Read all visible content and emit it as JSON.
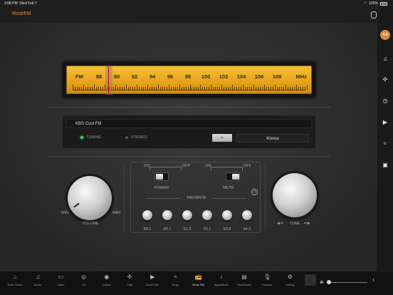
{
  "status": {
    "time": "2:08 PM",
    "date": "Wed Feb 7",
    "battery": "100%"
  },
  "app": {
    "title": "RoseFM",
    "accent": "#e98a3a"
  },
  "dial": {
    "band": "FM",
    "unit": "MHz",
    "numbers": [
      "88",
      "90",
      "92",
      "94",
      "96",
      "98",
      "100",
      "102",
      "104",
      "106",
      "108"
    ],
    "frequency_mhz": 89.1,
    "range_mhz": [
      87.5,
      108.5
    ]
  },
  "station": {
    "name": "KBS Cool FM",
    "tuning_label": "TUNING",
    "stereo_label": "STEREO",
    "tuning_on": true,
    "stereo_on": false,
    "region": "Korea"
  },
  "volume": {
    "label": "VOLUME",
    "min": "MIN",
    "max": "MAX"
  },
  "power": {
    "on": "ON",
    "off": "OFF",
    "label": "POWER",
    "state": "on"
  },
  "mute": {
    "on": "ON",
    "off": "OFF",
    "label": "MUTE",
    "state": "off"
  },
  "help": "?",
  "favorite": {
    "label": "FAVORITE",
    "stations": [
      "89.1",
      "89.7",
      "91.9",
      "93.1",
      "93.9",
      "94.5"
    ]
  },
  "tune": {
    "label": "TUNE"
  },
  "sidebar": [
    {
      "icon": "active-badge-icon",
      "glyph": "4:0",
      "active": true
    },
    {
      "icon": "music-note-icon",
      "glyph": "♫",
      "active": false
    },
    {
      "icon": "tidal-icon",
      "glyph": "✣",
      "active": false
    },
    {
      "icon": "clock-icon",
      "glyph": "◷",
      "active": false
    },
    {
      "icon": "youtube-icon",
      "glyph": "▶",
      "active": false
    },
    {
      "icon": "bugs-icon",
      "glyph": "≈",
      "active": false
    },
    {
      "icon": "roon-icon",
      "glyph": "▣",
      "active": false
    }
  ],
  "nav": [
    {
      "label": "Rose Home",
      "icon": "home-icon",
      "glyph": "⌂"
    },
    {
      "label": "Music",
      "icon": "music-icon",
      "glyph": "♫"
    },
    {
      "label": "Video",
      "icon": "video-icon",
      "glyph": "▭"
    },
    {
      "label": "CD",
      "icon": "cd-icon",
      "glyph": "◎"
    },
    {
      "label": "QoBuz",
      "icon": "qobuz-icon",
      "glyph": "◉"
    },
    {
      "label": "Tidal",
      "icon": "tidal-icon",
      "glyph": "✣"
    },
    {
      "label": "RoseTube",
      "icon": "rosetube-icon",
      "glyph": "▶"
    },
    {
      "label": "Bugs",
      "icon": "bugs-icon",
      "glyph": "≈"
    },
    {
      "label": "Rose FM",
      "icon": "radio-icon",
      "glyph": "📻",
      "active": true
    },
    {
      "label": "AppleMusic",
      "icon": "applemusic-icon",
      "glyph": "♪"
    },
    {
      "label": "RoseRadio",
      "icon": "roseradio-icon",
      "glyph": "▤"
    },
    {
      "label": "Podcast",
      "icon": "podcast-icon",
      "glyph": "🎙"
    },
    {
      "label": "Setting",
      "icon": "gear-icon",
      "glyph": "⚙"
    }
  ],
  "player": {
    "volume_value": "1",
    "volume_fraction": 0.0
  }
}
